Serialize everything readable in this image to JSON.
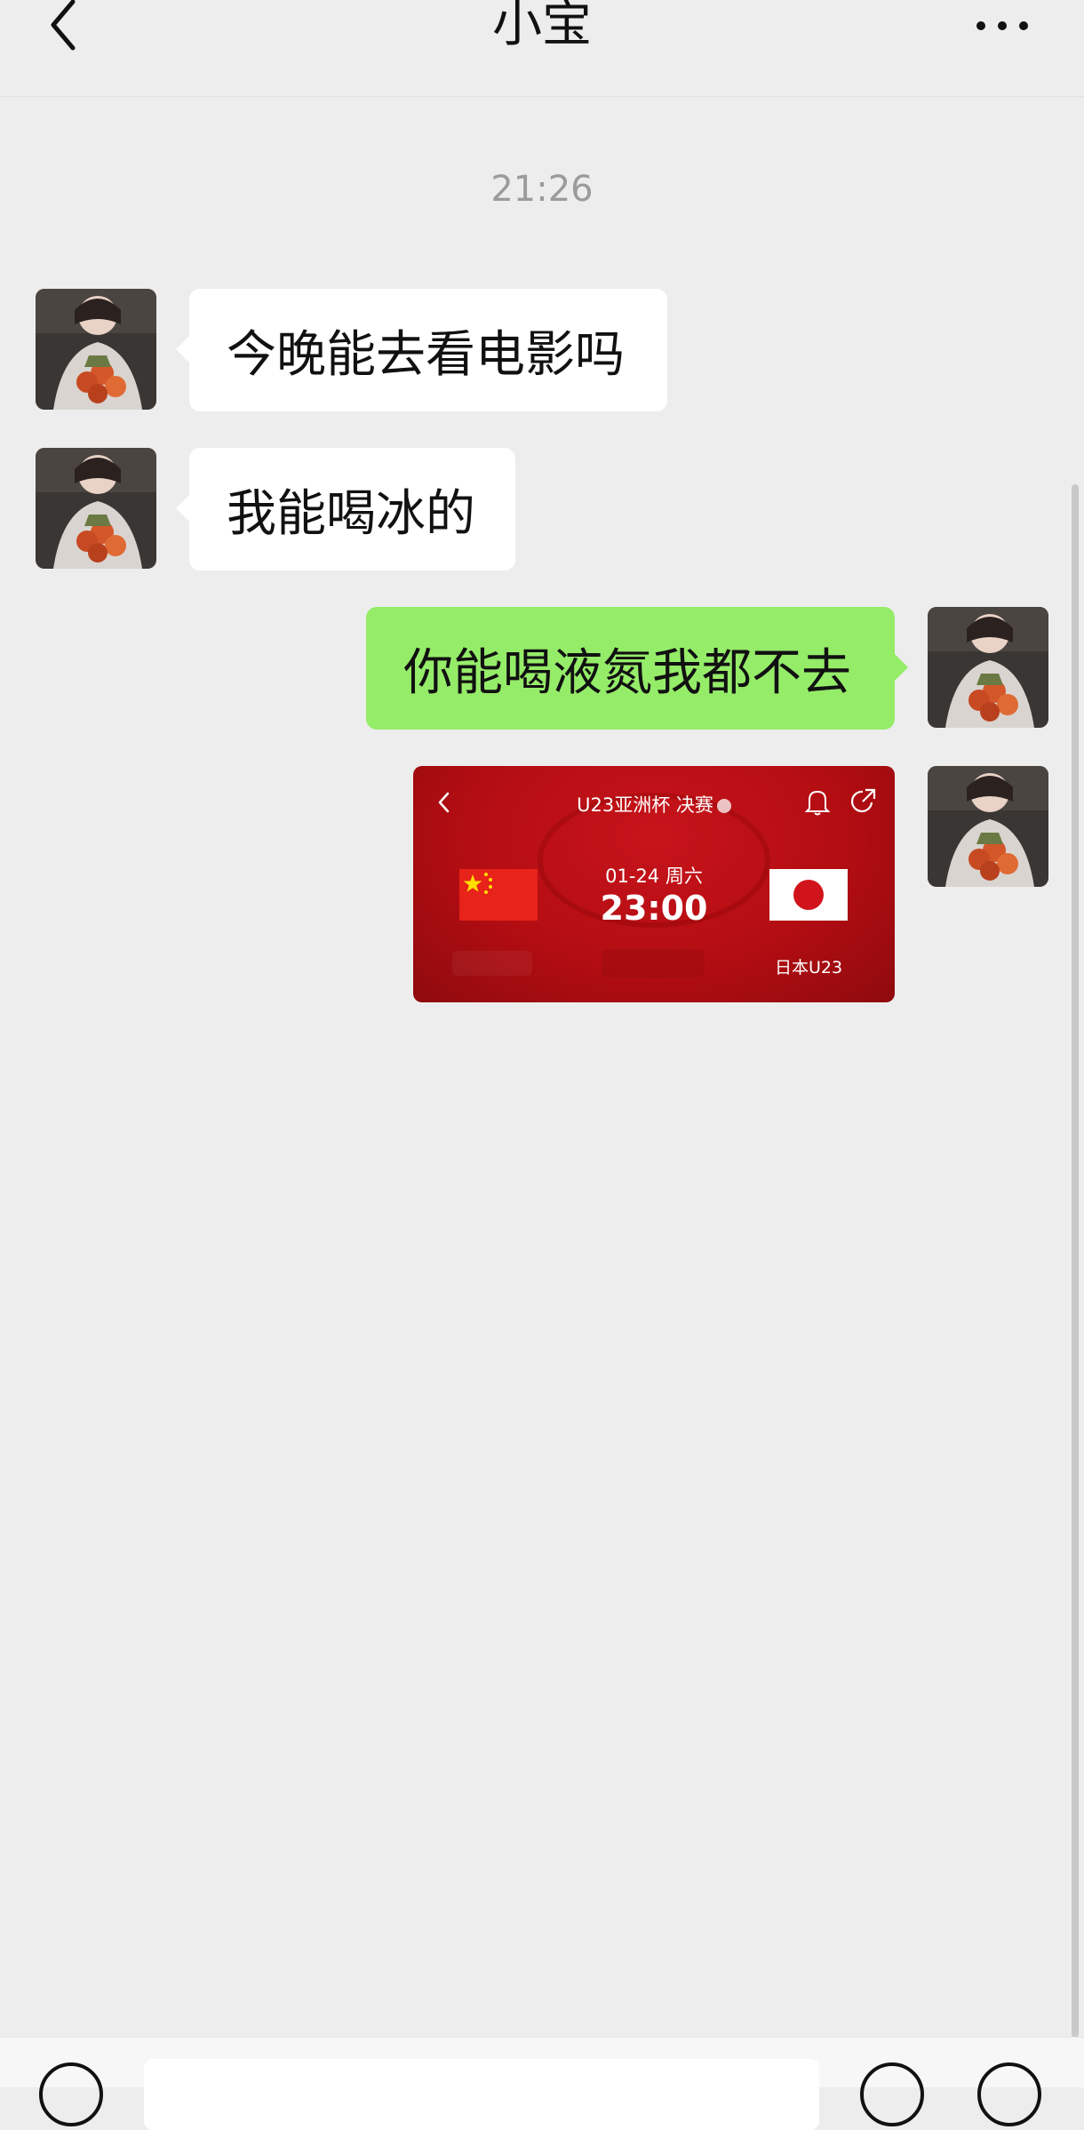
{
  "header": {
    "title": "小宝",
    "back_icon": "chevron-left-icon",
    "more_icon": "more-dots-icon"
  },
  "chat": {
    "timestamp": "21:26",
    "messages": [
      {
        "direction": "incoming",
        "type": "text",
        "text": "今晚能去看电影吗"
      },
      {
        "direction": "incoming",
        "type": "text",
        "text": "我能喝冰的"
      },
      {
        "direction": "outgoing",
        "type": "text",
        "text": "你能喝液氮我都不去"
      },
      {
        "direction": "outgoing",
        "type": "image",
        "card": {
          "title": "U23亚洲杯 决赛",
          "date": "01-24 周六",
          "time": "23:00",
          "team_home_flag": "china-flag",
          "team_away_flag": "japan-flag",
          "team_away": "日本U23"
        }
      }
    ]
  },
  "colors": {
    "background": "#ededed",
    "incoming_bubble": "#ffffff",
    "outgoing_bubble": "#95ec69",
    "card_red": "#b30d12"
  },
  "input_bar": {
    "voice_icon": "voice-icon",
    "emoji_icon": "emoji-icon",
    "plus_icon": "plus-icon"
  }
}
